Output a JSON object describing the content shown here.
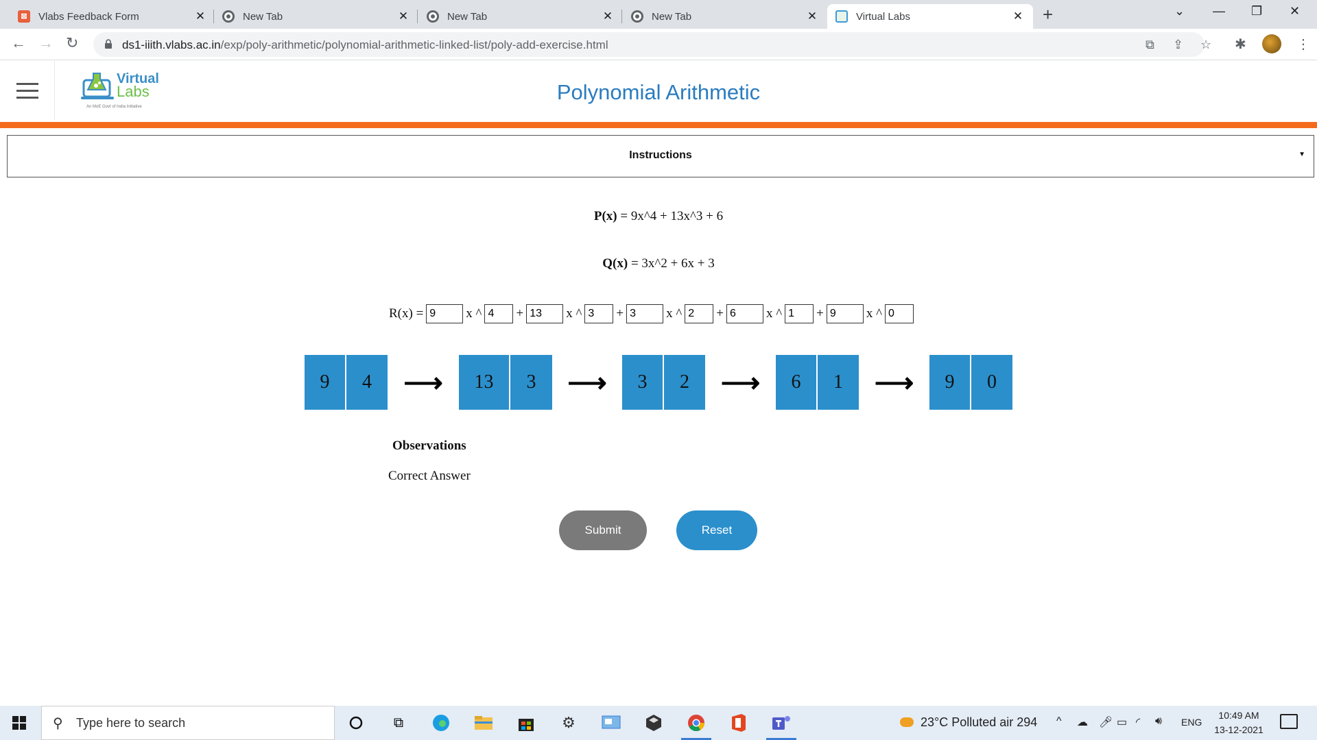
{
  "browser": {
    "tabs": [
      {
        "title": "Vlabs Feedback Form",
        "icon": "vlabs-icon",
        "active": false
      },
      {
        "title": "New Tab",
        "icon": "chrome-icon",
        "active": false
      },
      {
        "title": "New Tab",
        "icon": "chrome-icon",
        "active": false
      },
      {
        "title": "New Tab",
        "icon": "chrome-icon",
        "active": false
      },
      {
        "title": "Virtual Labs",
        "icon": "virtual-labs-icon",
        "active": true
      }
    ],
    "url_host": "ds1-iiith.vlabs.ac.in",
    "url_path": "/exp/poly-arithmetic/polynomial-arithmetic-linked-list/poly-add-exercise.html"
  },
  "header": {
    "logo_word1": "Virtual",
    "logo_word2": "Labs",
    "logo_tagline": "An MoE Govt of India Initiative",
    "title": "Polynomial Arithmetic"
  },
  "instructions": {
    "label": "Instructions"
  },
  "exercise": {
    "p_label": "P(x)",
    "p_expr": " = 9x^4 + 13x^3 + 6",
    "q_label": "Q(x)",
    "q_expr": " = 3x^2 + 6x + 3",
    "r_label": "R(x) =",
    "x_caret": "x ^",
    "plus": "+",
    "terms": [
      {
        "coef": "9",
        "exp": "4"
      },
      {
        "coef": "13",
        "exp": "3"
      },
      {
        "coef": "3",
        "exp": "2"
      },
      {
        "coef": "6",
        "exp": "1"
      },
      {
        "coef": "9",
        "exp": "0"
      }
    ],
    "nodes": [
      [
        "9",
        "4"
      ],
      [
        "13",
        "3"
      ],
      [
        "3",
        "2"
      ],
      [
        "6",
        "1"
      ],
      [
        "9",
        "0"
      ]
    ],
    "arrow": "⟶"
  },
  "observations": {
    "title": "Observations",
    "text": "Correct Answer"
  },
  "buttons": {
    "submit": "Submit",
    "reset": "Reset"
  },
  "taskbar": {
    "search_placeholder": "Type here to search",
    "weather": "23°C  Polluted air 294",
    "language": "ENG",
    "time": "10:49 AM",
    "date": "13-12-2021"
  },
  "colors": {
    "accent_orange": "#f56b1c",
    "node_blue": "#2b8fcc",
    "title_blue": "#2a7cc0",
    "submit_gray": "#7a7a7a"
  }
}
